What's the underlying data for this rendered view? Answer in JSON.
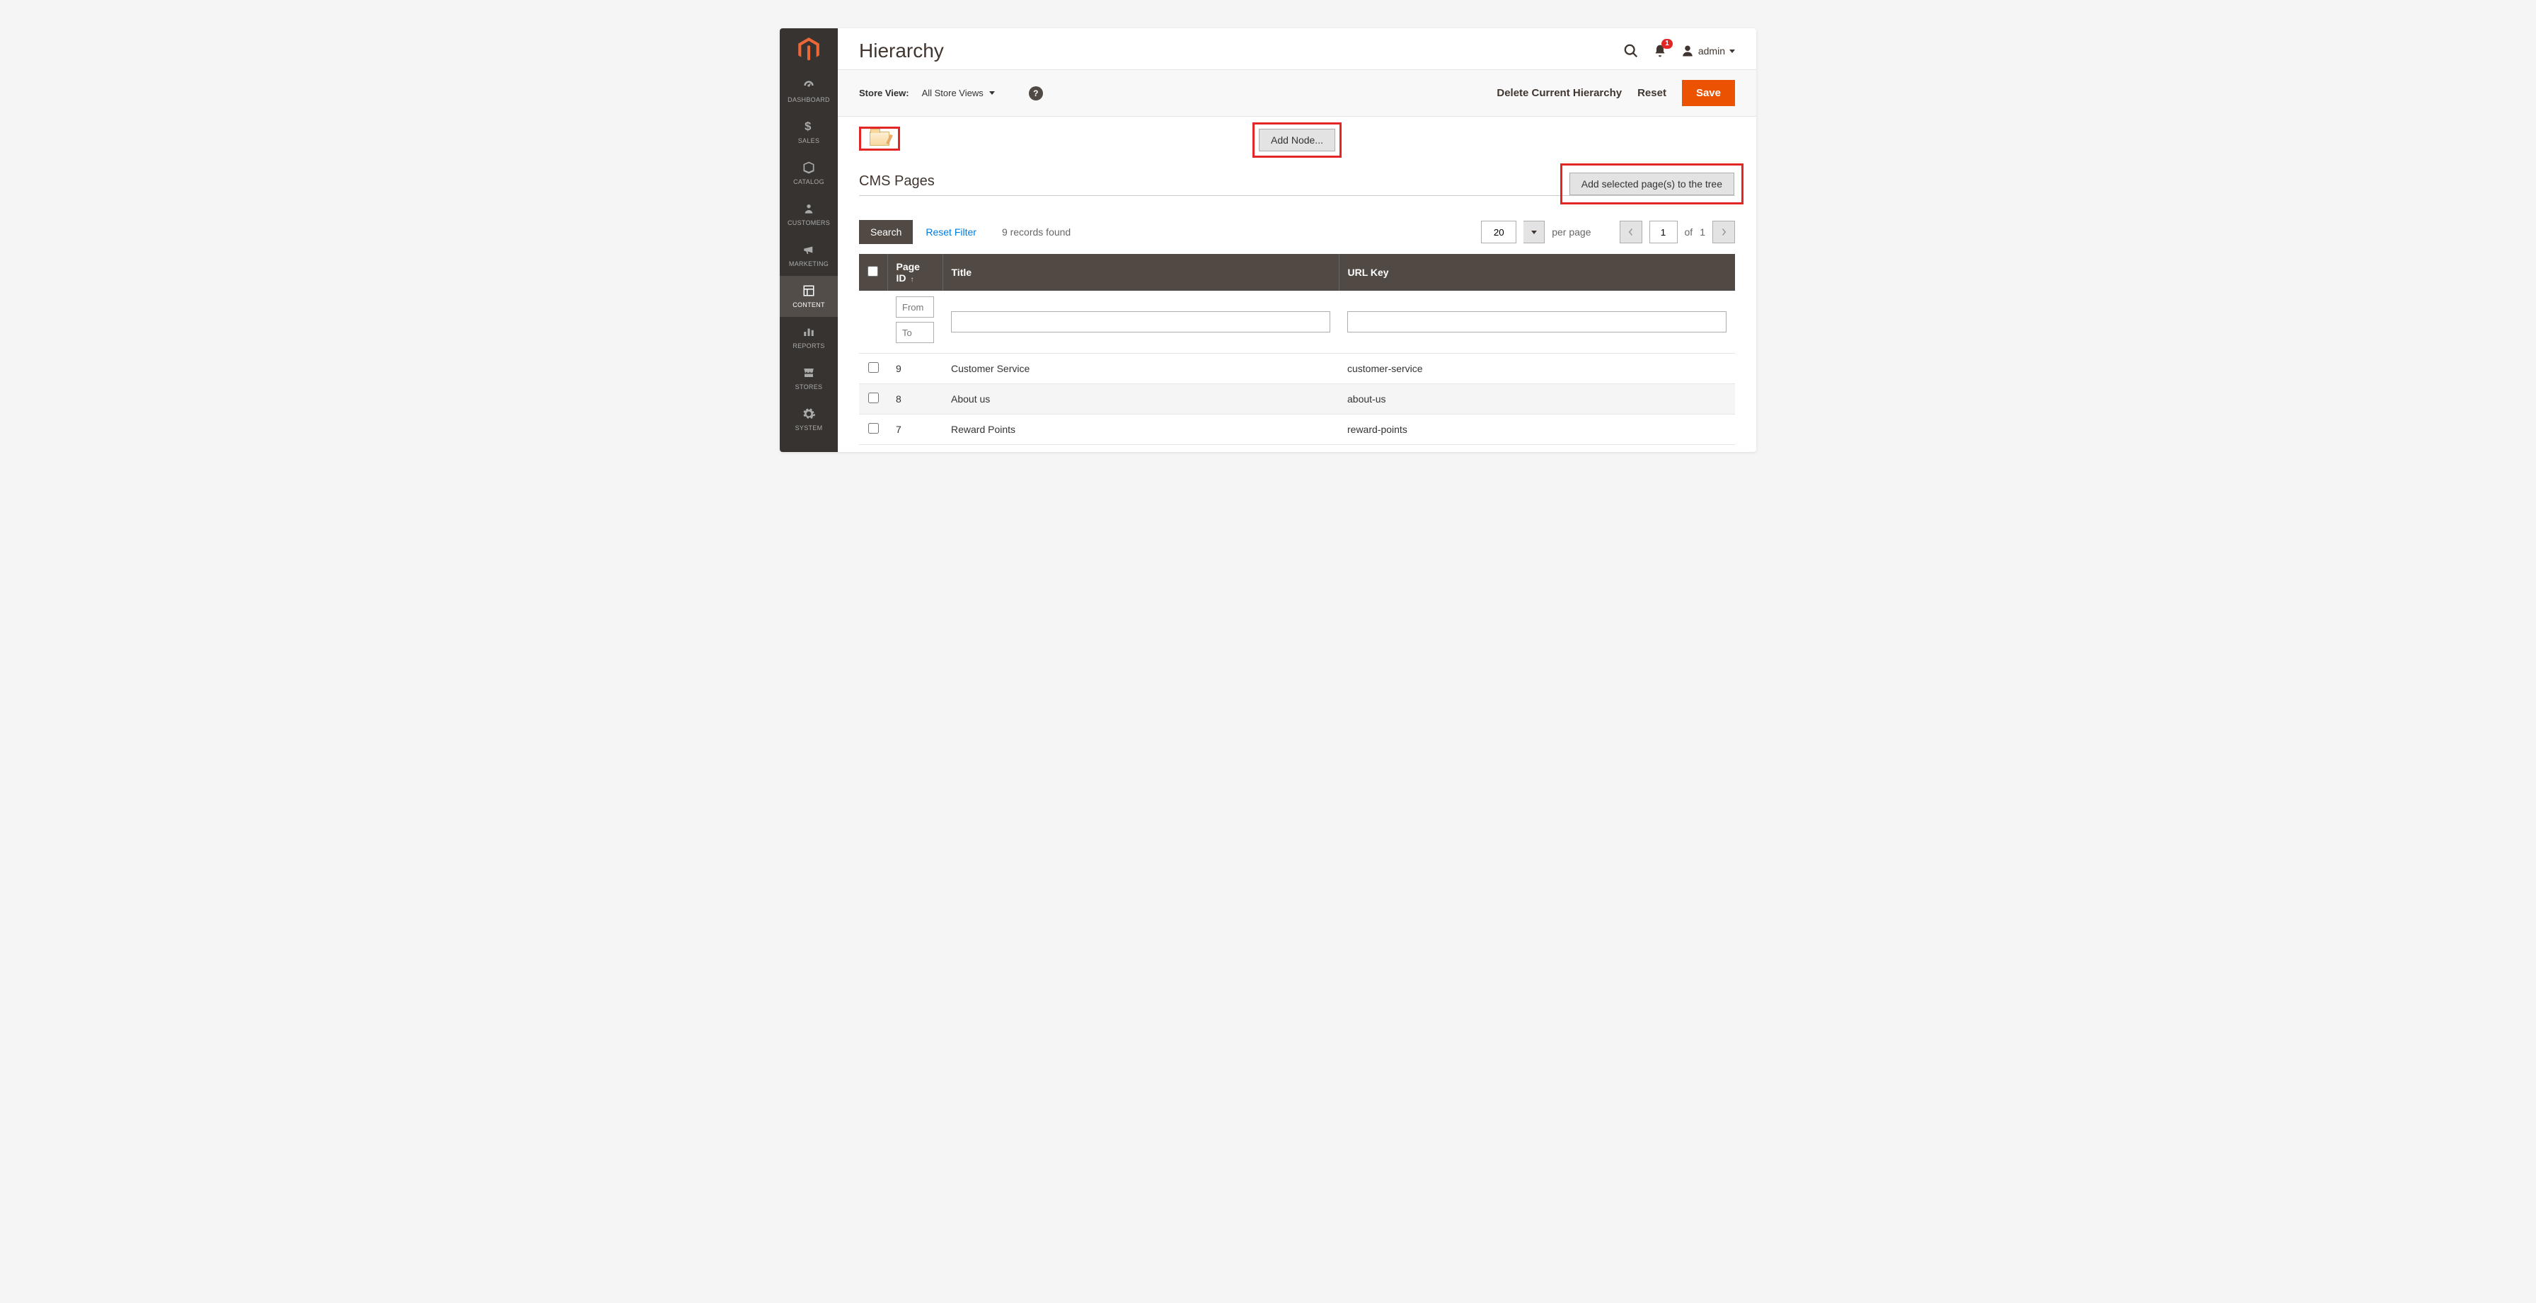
{
  "page_title": "Hierarchy",
  "topbar": {
    "notification_count": "1",
    "admin_label": "admin"
  },
  "store_bar": {
    "label": "Store View:",
    "selected": "All Store Views",
    "help": "?",
    "delete": "Delete Current Hierarchy",
    "reset": "Reset",
    "save": "Save"
  },
  "tree": {
    "add_node": "Add Node..."
  },
  "section": {
    "title": "CMS Pages",
    "add_selected": "Add selected page(s) to the tree"
  },
  "grid_controls": {
    "search": "Search",
    "reset_filter": "Reset Filter",
    "records_found": "9 records found",
    "per_page_value": "20",
    "per_page_label": "per page",
    "page_value": "1",
    "of_label": "of",
    "total_pages": "1"
  },
  "grid_headers": {
    "page_id": "Page ID",
    "title": "Title",
    "url_key": "URL Key"
  },
  "filter_placeholders": {
    "from": "From",
    "to": "To"
  },
  "rows": [
    {
      "id": "9",
      "title": "Customer Service",
      "url_key": "customer-service"
    },
    {
      "id": "8",
      "title": "About us",
      "url_key": "about-us"
    },
    {
      "id": "7",
      "title": "Reward Points",
      "url_key": "reward-points"
    }
  ],
  "sidebar": {
    "items": [
      {
        "label": "DASHBOARD"
      },
      {
        "label": "SALES"
      },
      {
        "label": "CATALOG"
      },
      {
        "label": "CUSTOMERS"
      },
      {
        "label": "MARKETING"
      },
      {
        "label": "CONTENT"
      },
      {
        "label": "REPORTS"
      },
      {
        "label": "STORES"
      },
      {
        "label": "SYSTEM"
      }
    ]
  }
}
